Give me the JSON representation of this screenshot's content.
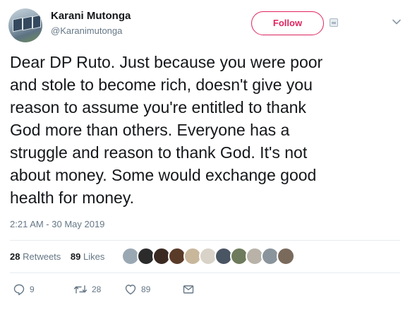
{
  "user": {
    "display_name": "Karani Mutonga",
    "handle": "@Karanimutonga",
    "follow_label": "Follow"
  },
  "tweet": {
    "text": "Dear DP Ruto. Just because you were poor\nand stole to become rich, doesn't give you\nreason to assume you're entitled to thank\nGod more than others. Everyone has a\nstruggle and reason to thank God. It's not\nabout money. Some would exchange good\nhealth for money.",
    "timestamp": "2:21 AM - 30 May 2019"
  },
  "stats": {
    "retweets_count": "28",
    "retweets_label": "Retweets",
    "likes_count": "89",
    "likes_label": "Likes"
  },
  "actions": {
    "reply_count": "9",
    "retweet_count": "28",
    "like_count": "89"
  },
  "colors": {
    "follow_accent": "#e0245e",
    "muted_text": "#657786",
    "divider": "#e6ecf0"
  },
  "icons": [
    "caret-down-icon",
    "reply-icon",
    "retweet-icon",
    "like-icon",
    "message-icon"
  ]
}
